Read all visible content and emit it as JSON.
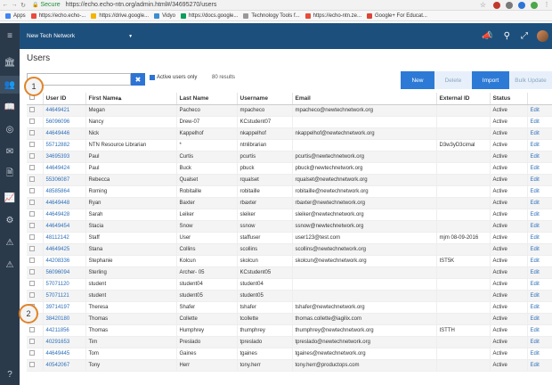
{
  "browser": {
    "secure": "Secure",
    "url": "https://echo.echo-ntn.org/admin.html#/34695270/users",
    "bookmarks": [
      "Apps",
      "https://echo.echo-...",
      "https://drive.google...",
      "Vidyo",
      "https://docs.google...",
      "Technology Tools f...",
      "https://echo-ntn.ze...",
      "Google+ For Educat..."
    ]
  },
  "topbar": {
    "network": "New Tech Network"
  },
  "page": {
    "title": "Users",
    "search_placeholder": "",
    "active_only_label": "Active users only",
    "results": "80 results",
    "buttons": {
      "new": "New",
      "delete": "Delete",
      "import": "Import",
      "bulk": "Bulk Update"
    },
    "callouts": [
      "1",
      "2"
    ]
  },
  "table": {
    "headers": [
      "",
      "User ID",
      "First Name▴",
      "Last Name",
      "Username",
      "Email",
      "External ID",
      "Status",
      ""
    ],
    "rows": [
      [
        "44649421",
        "Megan",
        "Pacheco",
        "mpacheco",
        "mpacheco@newtechnetwork.org",
        "",
        "Active",
        "Edit"
      ],
      [
        "56096096",
        "Nancy",
        "Drew-07",
        "KCstudent07",
        "",
        "",
        "Active",
        "Edit"
      ],
      [
        "44649446",
        "Nick",
        "Kappelhof",
        "nkappelhof",
        "nkappelhof@newtechnetwork.org",
        "",
        "Active",
        "Edit"
      ],
      [
        "55712882",
        "NTN Resource Librarian",
        "*",
        "ntnlibrarian",
        "",
        "D3w3yD3cimal",
        "Active",
        "Edit"
      ],
      [
        "34695393",
        "Paul",
        "Curtis",
        "pcurtis",
        "pcurtis@newtechnetwork.org",
        "",
        "Active",
        "Edit"
      ],
      [
        "44649424",
        "Paul",
        "Buck",
        "pbuck",
        "pbuck@newtechnetwork.org",
        "",
        "Active",
        "Edit"
      ],
      [
        "55306087",
        "Rebecca",
        "Qualset",
        "rqualset",
        "rqualset@newtechnetwork.org",
        "",
        "Active",
        "Edit"
      ],
      [
        "48585864",
        "Roming",
        "Robitaille",
        "robitaille",
        "robitaille@newtechnetwork.org",
        "",
        "Active",
        "Edit"
      ],
      [
        "44649448",
        "Ryan",
        "Baxter",
        "rbaxter",
        "rbaxter@newtechnetwork.org",
        "",
        "Active",
        "Edit"
      ],
      [
        "44649428",
        "Sarah",
        "Leiker",
        "sleiker",
        "sleiker@newtechnetwork.org",
        "",
        "Active",
        "Edit"
      ],
      [
        "44649454",
        "Stacia",
        "Snow",
        "ssnow",
        "ssnow@newtechnetwork.org",
        "",
        "Active",
        "Edit"
      ],
      [
        "48112142",
        "Staff",
        "User",
        "staffuser",
        "user123@test.com",
        "mjm 08-09-2016",
        "Active",
        "Edit"
      ],
      [
        "44649425",
        "Stana",
        "Collins",
        "scollins",
        "scollins@newtechnetwork.org",
        "",
        "Active",
        "Edit"
      ],
      [
        "44208336",
        "Stephanie",
        "Kolcun",
        "skolcun",
        "skolcun@newtechnetwork.org",
        "IST5K",
        "Active",
        "Edit"
      ],
      [
        "56096094",
        "Sterling",
        "Archer- 05",
        "KCstudent05",
        "",
        "",
        "Active",
        "Edit"
      ],
      [
        "57071120",
        "student",
        "student04",
        "student04",
        "",
        "",
        "Active",
        "Edit"
      ],
      [
        "57071121",
        "student",
        "student05",
        "student05",
        "",
        "",
        "Active",
        "Edit"
      ],
      [
        "39714197",
        "Theresa",
        "Shafer",
        "tshafer",
        "tshafer@newtechnetwork.org",
        "",
        "Active",
        "Edit"
      ],
      [
        "38420180",
        "Thomas",
        "Collette",
        "tcollette",
        "thomas.collette@iagilix.com",
        "",
        "Active",
        "Edit"
      ],
      [
        "44211856",
        "Thomas",
        "Humphrey",
        "thumphrey",
        "thumphrey@newtechnetwork.org",
        "ISTTH",
        "Active",
        "Edit"
      ],
      [
        "40291653",
        "Tim",
        "Preslado",
        "tpreslado",
        "tpreslado@newtechnetwork.org",
        "",
        "Active",
        "Edit"
      ],
      [
        "44649445",
        "Tom",
        "Gaines",
        "tgaines",
        "tgaines@newtechnetwork.org",
        "",
        "Active",
        "Edit"
      ],
      [
        "40542067",
        "Tony",
        "Herr",
        "tony.herr",
        "tony.herr@productops.com",
        "",
        "Active",
        "Edit"
      ]
    ]
  },
  "colors": {
    "topbar": "#1d4f7c",
    "sidebar": "#2b3a4a",
    "accent": "#2d7ad6",
    "callout_ring": "#e0842b"
  }
}
